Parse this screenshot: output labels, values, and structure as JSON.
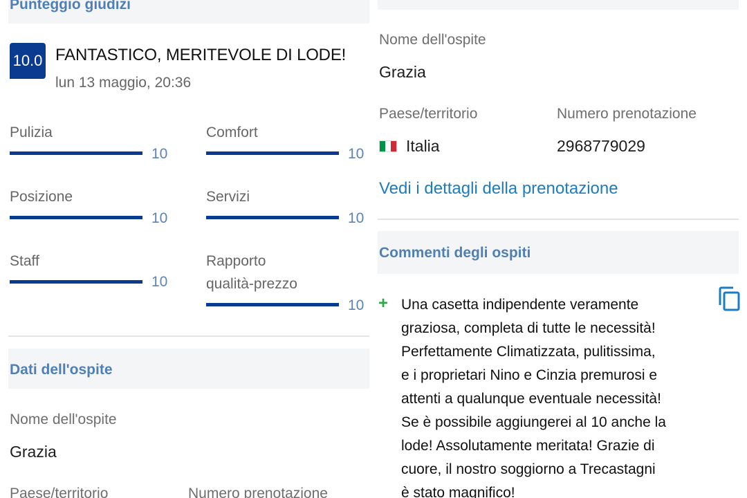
{
  "left": {
    "score_section_title": "Punteggio giudizi",
    "score": "10.0",
    "review_title": "FANTASTICO,  MERITEVOLE DI LODE!",
    "review_date": "lun 13 maggio, 20:36",
    "categories": [
      {
        "label": "Pulizia",
        "value": "10",
        "score": 1.0
      },
      {
        "label": "Comfort",
        "value": "10",
        "score": 1.0
      },
      {
        "label": "Posizione",
        "value": "10",
        "score": 1.0
      },
      {
        "label": "Servizi",
        "value": "10",
        "score": 1.0
      },
      {
        "label": "Staff",
        "value": "10",
        "score": 1.0
      },
      {
        "label": "Rapporto",
        "label2": "qualità-prezzo",
        "value": "10",
        "score": 1.0
      }
    ],
    "guest_section_title": "Dati dell'ospite",
    "guest_name_label": "Nome dell'ospite",
    "guest_name": "Grazia",
    "country_label": "Paese/territorio",
    "booking_label": "Numero prenotazione"
  },
  "right": {
    "guest_name_label": "Nome dell'ospite",
    "guest_name": "Grazia",
    "country_label": "Paese/territorio",
    "country": "Italia",
    "booking_label": "Numero prenotazione",
    "booking_number": "2968779029",
    "details_link": "Vedi i dettagli della prenotazione",
    "comments_section_title": "Commenti degli ospiti",
    "plus_sign": "+",
    "comment_lines": [
      "Una casetta indipendente veramente",
      "graziosa, completa di tutte le necessità!",
      "Perfettamente Climatizzata, pulitissima,",
      "e i proprietari Nino e Cinzia premurosi e",
      "attenti a qualunque eventuale necessità!",
      "Se è possibile aggiungerei al 10 anche la",
      "lode! Assolutamente meritata! Grazie di",
      "cuore, il nostro soggiorno a Trecastagni",
      "è stato magnifico!"
    ]
  },
  "colors": {
    "brand_blue": "#0b3b91",
    "section_title": "#4f7fb4",
    "link": "#1d7cc1",
    "positive": "#2aa845",
    "italy_flag": [
      "#009246",
      "#ffffff",
      "#ce2b37"
    ]
  },
  "icons": {
    "copy": "copy-icon",
    "flag": "italy-flag-icon"
  }
}
